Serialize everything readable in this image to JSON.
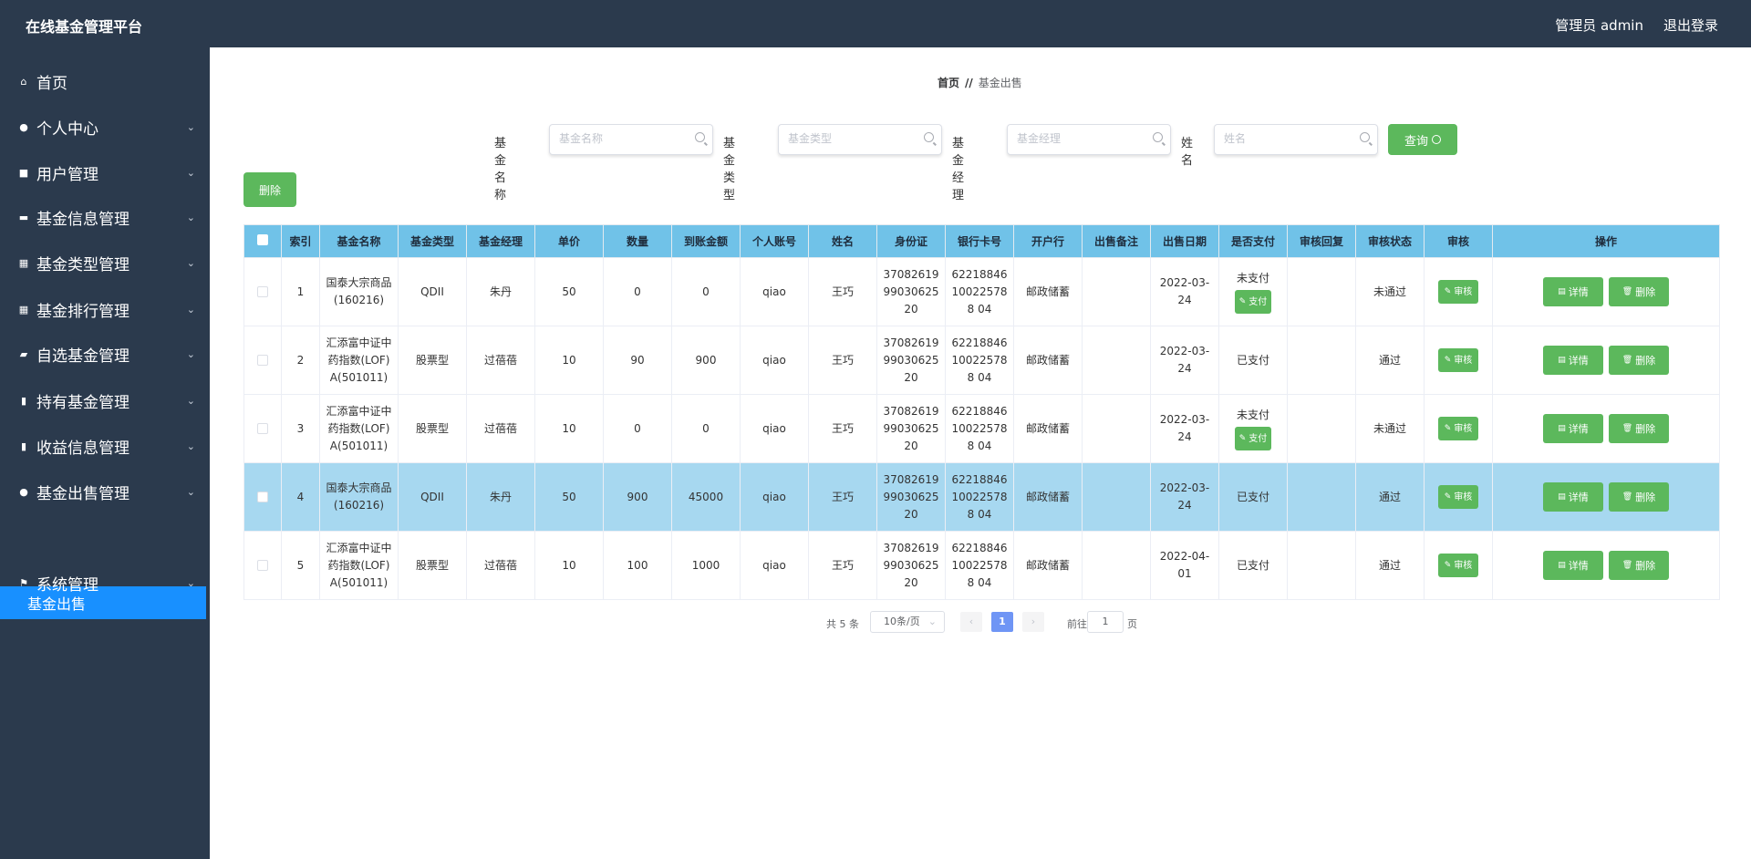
{
  "app": {
    "title": "在线基金管理平台",
    "user": "管理员 admin",
    "logout": "退出登录"
  },
  "sidebar": {
    "items": [
      {
        "label": "首页",
        "icon": "home-icon",
        "glyph": "⌂",
        "arrow": false
      },
      {
        "label": "个人中心",
        "icon": "user-icon",
        "glyph": "●",
        "arrow": true
      },
      {
        "label": "用户管理",
        "icon": "chat-icon",
        "glyph": "■",
        "arrow": true
      },
      {
        "label": "基金信息管理",
        "icon": "ticket-icon",
        "glyph": "▬",
        "arrow": true
      },
      {
        "label": "基金类型管理",
        "icon": "grid-icon",
        "glyph": "▦",
        "arrow": true
      },
      {
        "label": "基金排行管理",
        "icon": "grid-icon",
        "glyph": "▦",
        "arrow": true
      },
      {
        "label": "自选基金管理",
        "icon": "briefcase-icon",
        "glyph": "▰",
        "arrow": true
      },
      {
        "label": "持有基金管理",
        "icon": "clipboard-icon",
        "glyph": "▮",
        "arrow": true
      },
      {
        "label": "收益信息管理",
        "icon": "chart-icon",
        "glyph": "▮",
        "arrow": true
      },
      {
        "label": "基金出售管理",
        "icon": "location-icon",
        "glyph": "●",
        "arrow": true
      },
      {
        "label": "系统管理",
        "icon": "flag-icon",
        "glyph": "⚑",
        "arrow": true
      }
    ],
    "active_sub": "基金出售",
    "arrow_glyph": "⌄"
  },
  "breadcrumb": {
    "home": "首页",
    "sep": "//",
    "current": "基金出售"
  },
  "search": {
    "fields": [
      {
        "label": "基金名称",
        "placeholder": "基金名称"
      },
      {
        "label": "基金类型",
        "placeholder": "基金类型"
      },
      {
        "label": "基金经理",
        "placeholder": "基金经理"
      },
      {
        "label": "姓名",
        "placeholder": "姓名"
      }
    ],
    "query_label": "查询"
  },
  "toolbar": {
    "delete_label": "删除"
  },
  "table": {
    "headers": [
      "索引",
      "基金名称",
      "基金类型",
      "基金经理",
      "单价",
      "数量",
      "到账金额",
      "个人账号",
      "姓名",
      "身份证",
      "银行卡号",
      "开户行",
      "出售备注",
      "出售日期",
      "是否支付",
      "审核回复",
      "审核状态",
      "审核",
      "操作"
    ],
    "rows": [
      {
        "index": "1",
        "fund_name": "国泰大宗商品(160216)",
        "fund_type": "QDII",
        "manager": "朱丹",
        "price": "50",
        "quantity": "0",
        "amount": "0",
        "account": "qiao",
        "name": "王巧",
        "id_card": "370826199903062520",
        "bank_card": "62218846100225788 04",
        "bank": "邮政储蓄",
        "remark": "",
        "date": "2022-03-24",
        "paid": "未支付",
        "pay_btn": "支付",
        "reply": "",
        "status": "未通过",
        "review_btn": "审核"
      },
      {
        "index": "2",
        "fund_name": "汇添富中证中药指数(LOF)A(501011)",
        "fund_type": "股票型",
        "manager": "过蓓蓓",
        "price": "10",
        "quantity": "90",
        "amount": "900",
        "account": "qiao",
        "name": "王巧",
        "id_card": "370826199903062520",
        "bank_card": "62218846100225788 04",
        "bank": "邮政储蓄",
        "remark": "",
        "date": "2022-03-24",
        "paid": "已支付",
        "pay_btn": "",
        "reply": "",
        "status": "通过",
        "review_btn": "审核"
      },
      {
        "index": "3",
        "fund_name": "汇添富中证中药指数(LOF)A(501011)",
        "fund_type": "股票型",
        "manager": "过蓓蓓",
        "price": "10",
        "quantity": "0",
        "amount": "0",
        "account": "qiao",
        "name": "王巧",
        "id_card": "370826199903062520",
        "bank_card": "62218846100225788 04",
        "bank": "邮政储蓄",
        "remark": "",
        "date": "2022-03-24",
        "paid": "未支付",
        "pay_btn": "支付",
        "reply": "",
        "status": "未通过",
        "review_btn": "审核"
      },
      {
        "index": "4",
        "fund_name": "国泰大宗商品(160216)",
        "fund_type": "QDII",
        "manager": "朱丹",
        "price": "50",
        "quantity": "900",
        "amount": "45000",
        "account": "qiao",
        "name": "王巧",
        "id_card": "370826199903062520",
        "bank_card": "62218846100225788 04",
        "bank": "邮政储蓄",
        "remark": "",
        "date": "2022-03-24",
        "paid": "已支付",
        "pay_btn": "",
        "reply": "",
        "status": "通过",
        "review_btn": "审核"
      },
      {
        "index": "5",
        "fund_name": "汇添富中证中药指数(LOF)A(501011)",
        "fund_type": "股票型",
        "manager": "过蓓蓓",
        "price": "10",
        "quantity": "100",
        "amount": "1000",
        "account": "qiao",
        "name": "王巧",
        "id_card": "370826199903062520",
        "bank_card": "62218846100225788 04",
        "bank": "邮政储蓄",
        "remark": "",
        "date": "2022-04-01",
        "paid": "已支付",
        "pay_btn": "",
        "reply": "",
        "status": "通过",
        "review_btn": "审核"
      }
    ],
    "detail_label": "详情",
    "delete_label": "删除",
    "highlighted_row": 4
  },
  "pagination": {
    "total": "共 5 条",
    "page_size": "10条/页",
    "current": "1",
    "goto_label": "前往",
    "goto_value": "1",
    "page_unit": "页"
  },
  "colors": {
    "sidebar_bg": "#2b3a4d",
    "header_bg": "#70c2e8",
    "accent_green": "#5cb85c",
    "active_blue": "#1890ff",
    "row_highlight": "#a7d8f0"
  }
}
